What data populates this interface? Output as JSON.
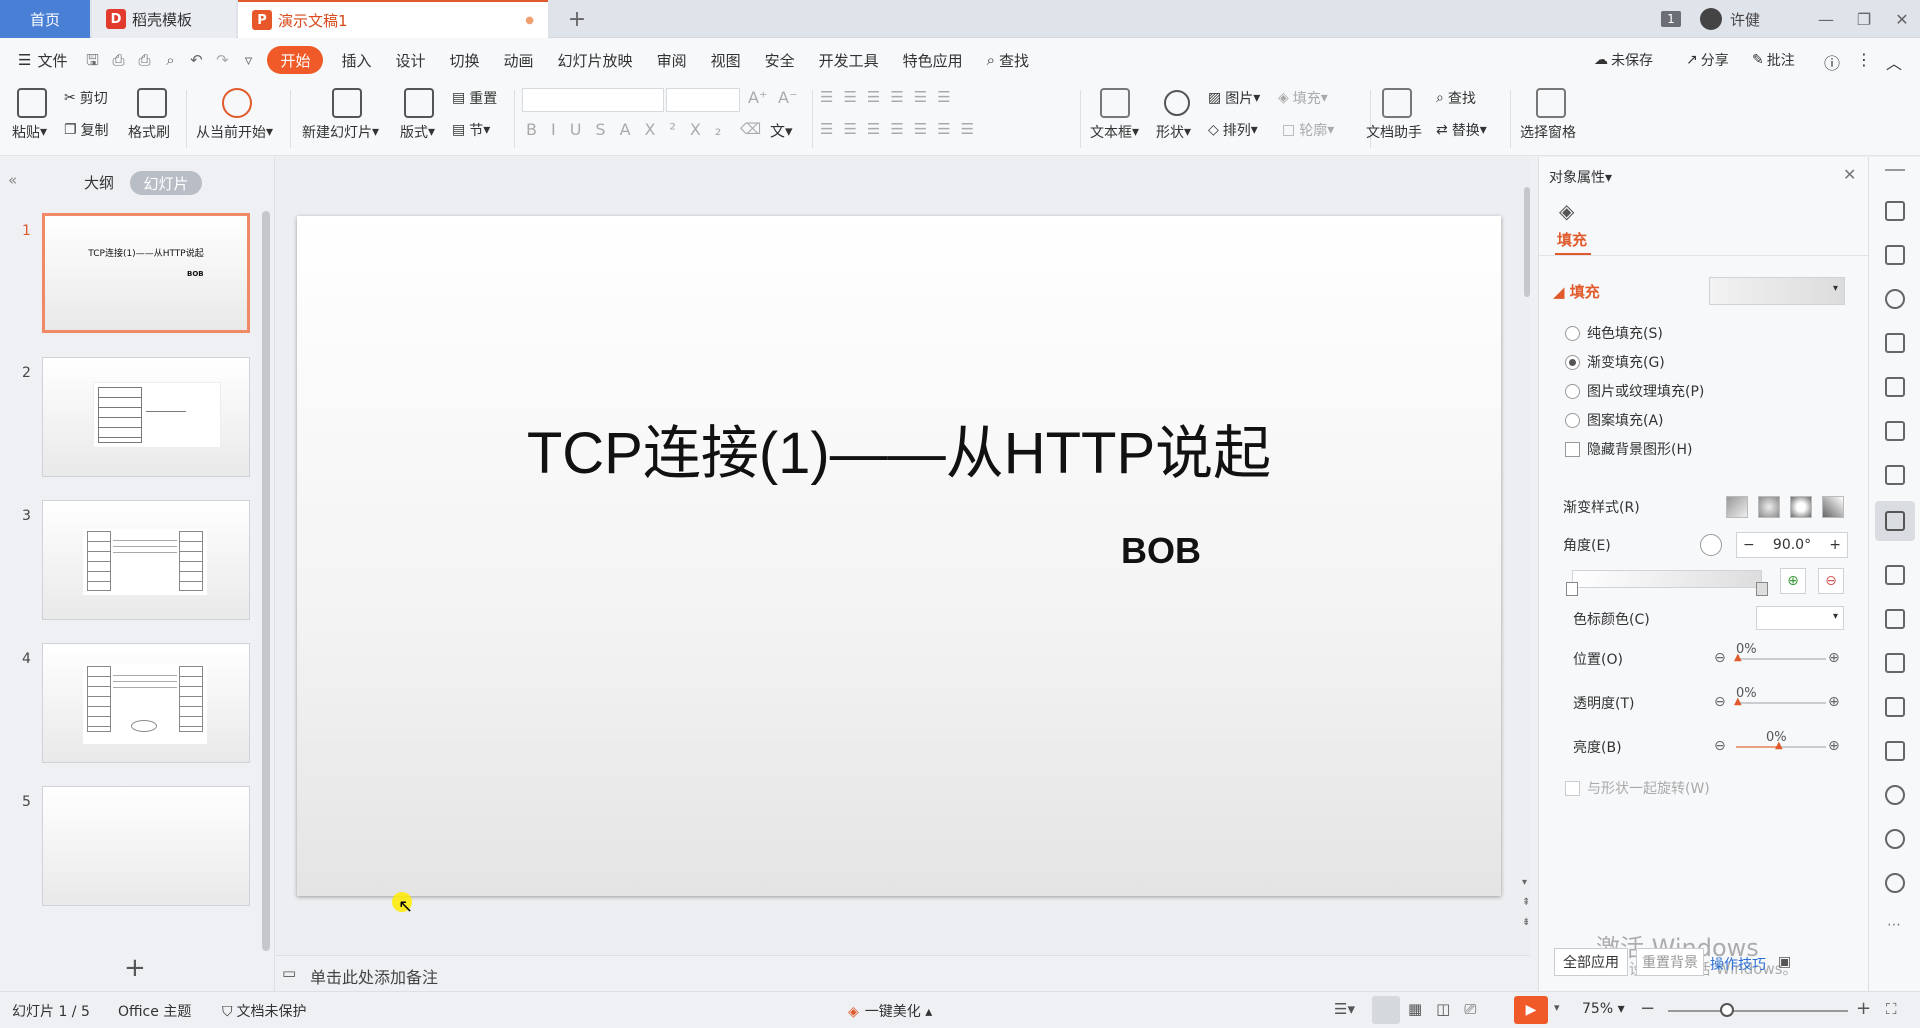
{
  "tabs": {
    "home": "首页",
    "template": "稻壳模板",
    "doc": "演示文稿1",
    "badge": "1",
    "user": "许健"
  },
  "menu": {
    "file": "文件",
    "items": [
      "开始",
      "插入",
      "设计",
      "切换",
      "动画",
      "幻灯片放映",
      "审阅",
      "视图",
      "安全",
      "开发工具",
      "特色应用"
    ],
    "search": "查找",
    "unsaved": "未保存",
    "share": "分享",
    "comment": "批注"
  },
  "ribbon": {
    "paste": "粘贴",
    "cut": "剪切",
    "copy": "复制",
    "format_painter": "格式刷",
    "from_current": "从当前开始",
    "new_slide": "新建幻灯片",
    "layout": "版式",
    "reset": "重置",
    "section": "节",
    "textbox": "文本框",
    "shape": "形状",
    "picture": "图片",
    "fill": "填充",
    "arrange": "排列",
    "outline": "轮廓",
    "doc_assistant": "文档助手",
    "find": "查找",
    "replace": "替换",
    "selection_pane": "选择窗格"
  },
  "left_panel": {
    "outline_tab": "大纲",
    "slides_tab": "幻灯片",
    "slide_numbers": [
      "1",
      "2",
      "3",
      "4",
      "5"
    ],
    "thumb1_title": "TCP连接(1)——从HTTP说起",
    "thumb1_sub": "BOB"
  },
  "slide": {
    "title": "TCP连接(1)——从HTTP说起",
    "subtitle": "BOB"
  },
  "notes_placeholder": "单击此处添加备注",
  "properties": {
    "header": "对象属性",
    "fill_tab": "填充",
    "fill_section": "填充",
    "solid": "纯色填充(S)",
    "gradient": "渐变填充(G)",
    "picture_texture": "图片或纹理填充(P)",
    "pattern": "图案填充(A)",
    "hide_bg": "隐藏背景图形(H)",
    "gradient_style": "渐变样式(R)",
    "angle": "角度(E)",
    "angle_value": "90.0°",
    "stop_color": "色标颜色(C)",
    "position": "位置(O)",
    "position_value": "0%",
    "transparency": "透明度(T)",
    "transparency_value": "0%",
    "brightness": "亮度(B)",
    "brightness_value": "0%",
    "rotate_with_shape": "与形状一起旋转(W)",
    "apply_all": "全部应用",
    "reset_bg": "重置背景",
    "tips": "操作技巧",
    "watermark1": "激活 Windows",
    "watermark2": "转到\"设置\"以激活 Windows。"
  },
  "status": {
    "slide_info": "幻灯片 1 / 5",
    "theme": "Office 主题",
    "protect": "文档未保护",
    "beautify": "一键美化",
    "zoom": "75%"
  },
  "colors": {
    "accent": "#f05a28",
    "home_tab": "#4a7fd6"
  }
}
